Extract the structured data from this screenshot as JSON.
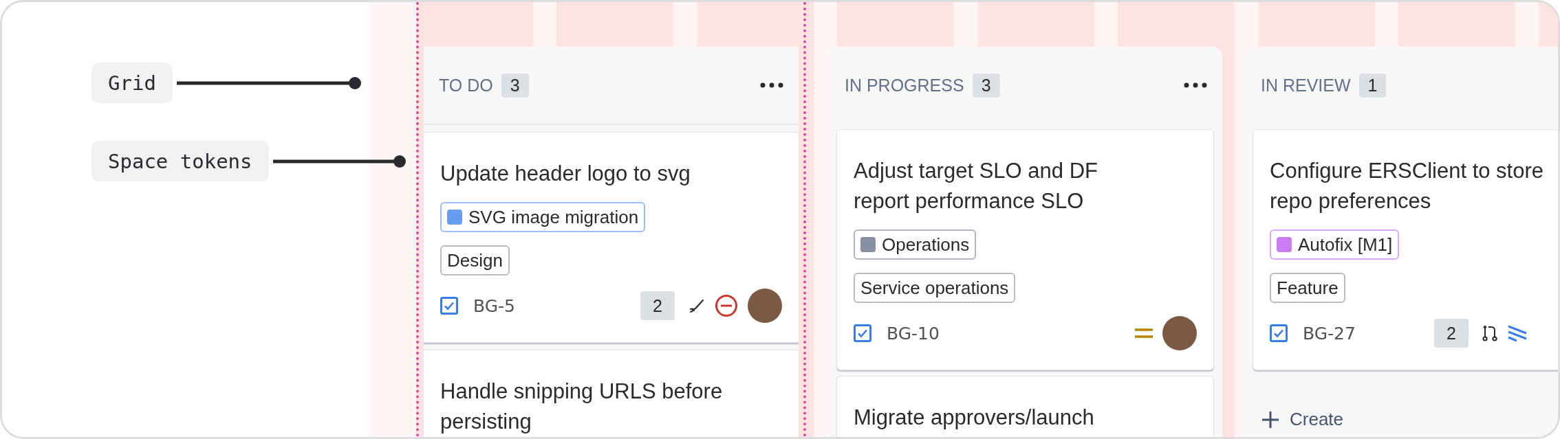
{
  "annotations": [
    {
      "label": "Grid"
    },
    {
      "label": "Space tokens"
    }
  ],
  "columns": [
    {
      "title": "TO DO",
      "count": "3",
      "guides": true,
      "cards": [
        {
          "title": "Update header logo to svg",
          "tags": [
            {
              "label": "SVG image migration",
              "color": "#669df1"
            },
            {
              "label": "Design"
            }
          ],
          "key": "BG-5",
          "count": "2",
          "indicators": [
            {
              "kind": "brush"
            },
            {
              "kind": "blocker"
            }
          ],
          "avatar": true
        },
        {
          "title": "Handle snipping URLS before persisting"
        }
      ]
    },
    {
      "title": "IN PROGRESS",
      "count": "3",
      "guides": false,
      "cards": [
        {
          "title": "Adjust target SLO and DF report performance SLO",
          "tags": [
            {
              "label": "Operations",
              "color": "#8590a2"
            },
            {
              "label": "Service operations"
            }
          ],
          "key": "BG-10",
          "indicators": [
            {
              "kind": "medium"
            }
          ],
          "avatar": true
        },
        {
          "title": "Migrate approvers/launch"
        }
      ]
    },
    {
      "title": "IN REVIEW",
      "count": "1",
      "guides": false,
      "create": "Create",
      "cards": [
        {
          "title": "Configure ERSClient to store repo preferences",
          "tags": [
            {
              "label": "Autofix [M1]",
              "color": "#c97cf4"
            },
            {
              "label": "Feature"
            }
          ],
          "key": "BG-27",
          "count": "2",
          "indicators": [
            {
              "kind": "pull-request"
            },
            {
              "kind": "lowest"
            }
          ]
        }
      ]
    }
  ]
}
